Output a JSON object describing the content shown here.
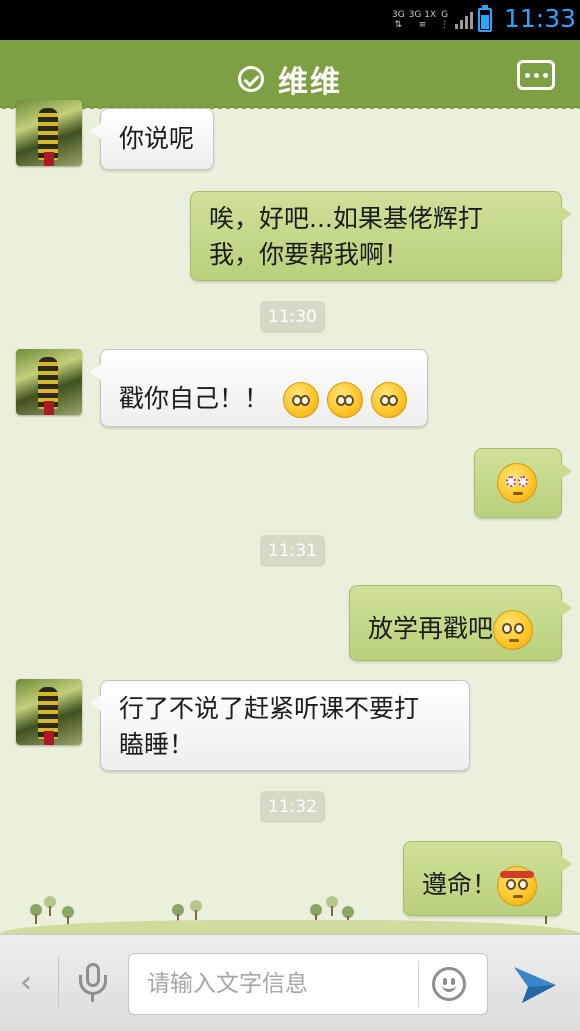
{
  "status_bar": {
    "network_left": "3G",
    "network_mid": "3G 1X",
    "network_right": "G",
    "time": "11:33"
  },
  "header": {
    "title": "维维",
    "verified_icon": "check-circle-icon",
    "menu_icon": "more-icon"
  },
  "messages": [
    {
      "side": "in",
      "text": "你说呢"
    },
    {
      "side": "out",
      "line1": "唉，好吧...如果基佬辉打",
      "line2": "我，你要帮我啊！"
    },
    {
      "timestamp": "11:30"
    },
    {
      "side": "in",
      "text": "戳你自己！！",
      "emojis": [
        "shocked-emoji",
        "shocked-emoji",
        "shocked-emoji"
      ]
    },
    {
      "side": "out",
      "emojis": [
        "dizzy-emoji"
      ]
    },
    {
      "timestamp": "11:31"
    },
    {
      "side": "out",
      "text": "放学再戳吧",
      "emojis": [
        "crying-emoji"
      ]
    },
    {
      "side": "in",
      "line1": "行了不说了赶紧听课不要打",
      "line2": "瞌睡！"
    },
    {
      "timestamp": "11:32"
    },
    {
      "side": "out",
      "text": "遵命！",
      "emojis": [
        "determined-emoji"
      ]
    }
  ],
  "input_bar": {
    "placeholder": "请输入文字信息",
    "back_icon": "chevron-left-icon",
    "voice_icon": "microphone-icon",
    "emoji_icon": "smiley-icon",
    "send_icon": "send-icon"
  },
  "colors": {
    "header": "#7ea045",
    "background": "#eaf0dc",
    "outgoing_bubble": "#c2d888",
    "incoming_bubble": "#ffffff",
    "clock": "#2ea3ff"
  }
}
